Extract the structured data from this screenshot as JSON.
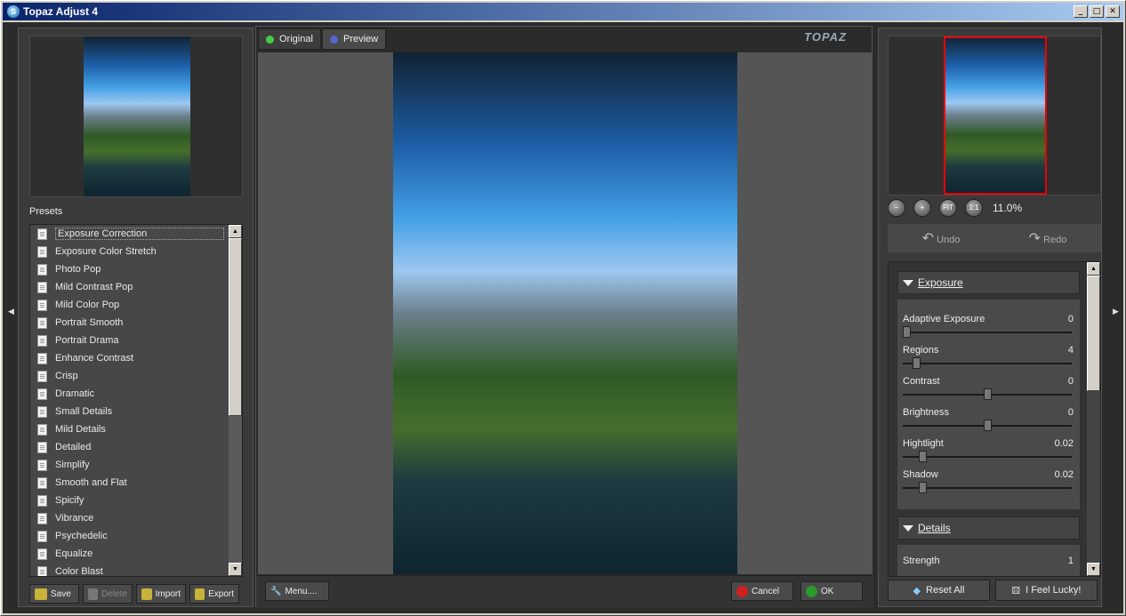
{
  "window": {
    "title": "Topaz Adjust 4"
  },
  "left": {
    "presets_label": "Presets",
    "presets": [
      "Exposure Correction",
      "Exposure Color Stretch",
      "Photo Pop",
      "Mild Contrast Pop",
      "Mild Color Pop",
      "Portrait Smooth",
      "Portrait Drama",
      "Enhance Contrast",
      "Crisp",
      "Dramatic",
      "Small Details",
      "Mild Details",
      "Detailed",
      "Simplify",
      "Smooth and Flat",
      "Spicify",
      "Vibrance",
      "Psychedelic",
      "Equalize",
      "Color Blast"
    ],
    "buttons": {
      "save": "Save",
      "delete": "Delete",
      "import": "Import",
      "export": "Export"
    }
  },
  "center": {
    "tab_original": "Original",
    "tab_preview": "Preview",
    "logo": "TOPAZ",
    "menu_label": "Menu....",
    "cancel_label": "Cancel",
    "ok_label": "OK"
  },
  "right": {
    "zoom": "11.0%",
    "zoom_buttons": [
      "−",
      "+",
      "FIT",
      "1:1"
    ],
    "undo": "Undo",
    "redo": "Redo",
    "exposure_title": "Exposure",
    "details_title": "Details",
    "sliders": [
      {
        "name": "Adaptive Exposure",
        "value": "0",
        "level": 0
      },
      {
        "name": "Regions",
        "value": "4",
        "level": 0.06
      },
      {
        "name": "Contrast",
        "value": "0",
        "level": 0.5
      },
      {
        "name": "Brightness",
        "value": "0",
        "level": 0.5
      },
      {
        "name": "Hightlight",
        "value": "0.02",
        "level": 0.1
      },
      {
        "name": "Shadow",
        "value": "0.02",
        "level": 0.1
      }
    ],
    "strength": {
      "name": "Strength",
      "value": "1"
    },
    "reset_label": "Reset All",
    "lucky_label": "I Feel Lucky!"
  },
  "colors": {
    "accent_red": "#e00000",
    "ok_green": "#2a9a2a",
    "cancel_red": "#d02020"
  }
}
